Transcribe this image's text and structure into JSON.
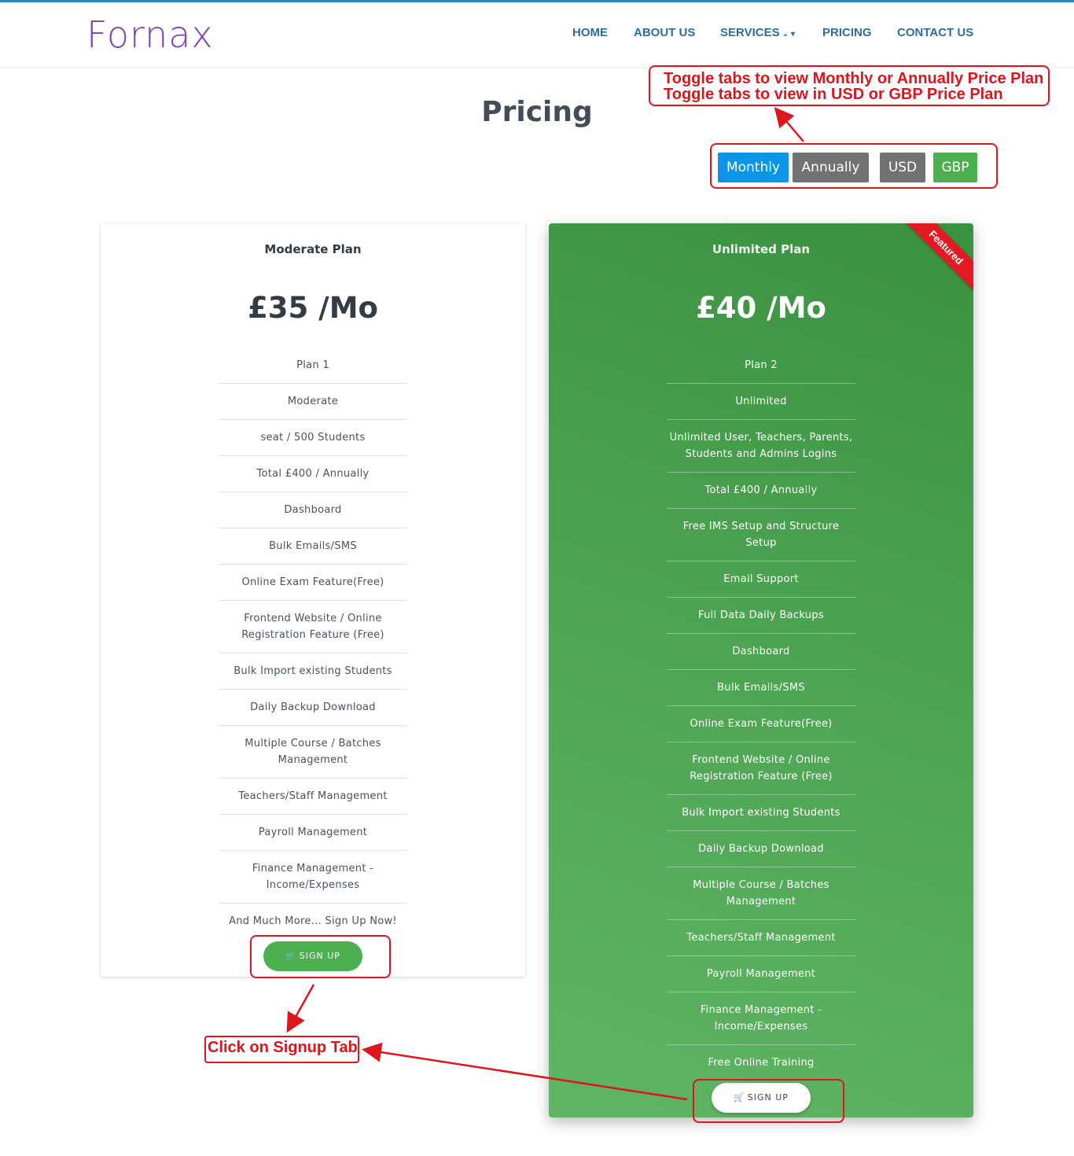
{
  "header": {
    "logo": "Fornax",
    "nav": [
      {
        "label": "HOME"
      },
      {
        "label": "ABOUT US"
      },
      {
        "label": "SERVICES"
      },
      {
        "label": "PRICING"
      },
      {
        "label": "CONTACT US"
      }
    ]
  },
  "page": {
    "title": "Pricing"
  },
  "toggles": [
    {
      "label": "Monthly",
      "color": "#0a95e8"
    },
    {
      "label": "Annually",
      "color": "#727272"
    },
    {
      "label": "USD",
      "color": "#727272"
    },
    {
      "label": "GBP",
      "color": "#4caf50"
    }
  ],
  "plans": {
    "moderate": {
      "name": "Moderate Plan",
      "price": "£35 /Mo",
      "features": [
        "Plan 1",
        "Moderate",
        "seat / 500 Students",
        "Total £400 / Annually",
        "Dashboard",
        "Bulk Emails/SMS",
        "Online Exam Feature(Free)",
        "Frontend Website / Online Registration Feature (Free)",
        "Bulk Import existing Students",
        "Daily Backup Download",
        "Multiple Course / Batches Management",
        "Teachers/Staff Management",
        "Payroll Management",
        "Finance Management - Income/Expenses",
        "And Much More... Sign Up Now!"
      ],
      "signup_label": "SIGN UP"
    },
    "unlimited": {
      "name": "Unlimited Plan",
      "price": "£40 /Mo",
      "ribbon": "Featured",
      "features": [
        "Plan 2",
        "Unlimited",
        "Unlimited User, Teachers, Parents, Students and Admins Logins",
        "Total £400 / Annually",
        "Free IMS Setup and Structure Setup",
        "Email Support",
        "Full Data Daily Backups",
        "Dashboard",
        "Bulk Emails/SMS",
        "Online Exam Feature(Free)",
        "Frontend Website / Online Registration Feature (Free)",
        "Bulk Import existing Students",
        "Daily Backup Download",
        "Multiple Course / Batches Management",
        "Teachers/Staff Management",
        "Payroll Management",
        "Finance Management - Income/Expenses",
        "Free Online Training"
      ],
      "signup_label": "SIGN UP"
    }
  },
  "annotations": {
    "toggle_line1": "Toggle tabs to view Monthly or Annually Price Plan",
    "toggle_line2": "Toggle tabs to view in USD or GBP Price Plan",
    "signup": "Click on Signup Tab",
    "color": "#e0141b"
  }
}
